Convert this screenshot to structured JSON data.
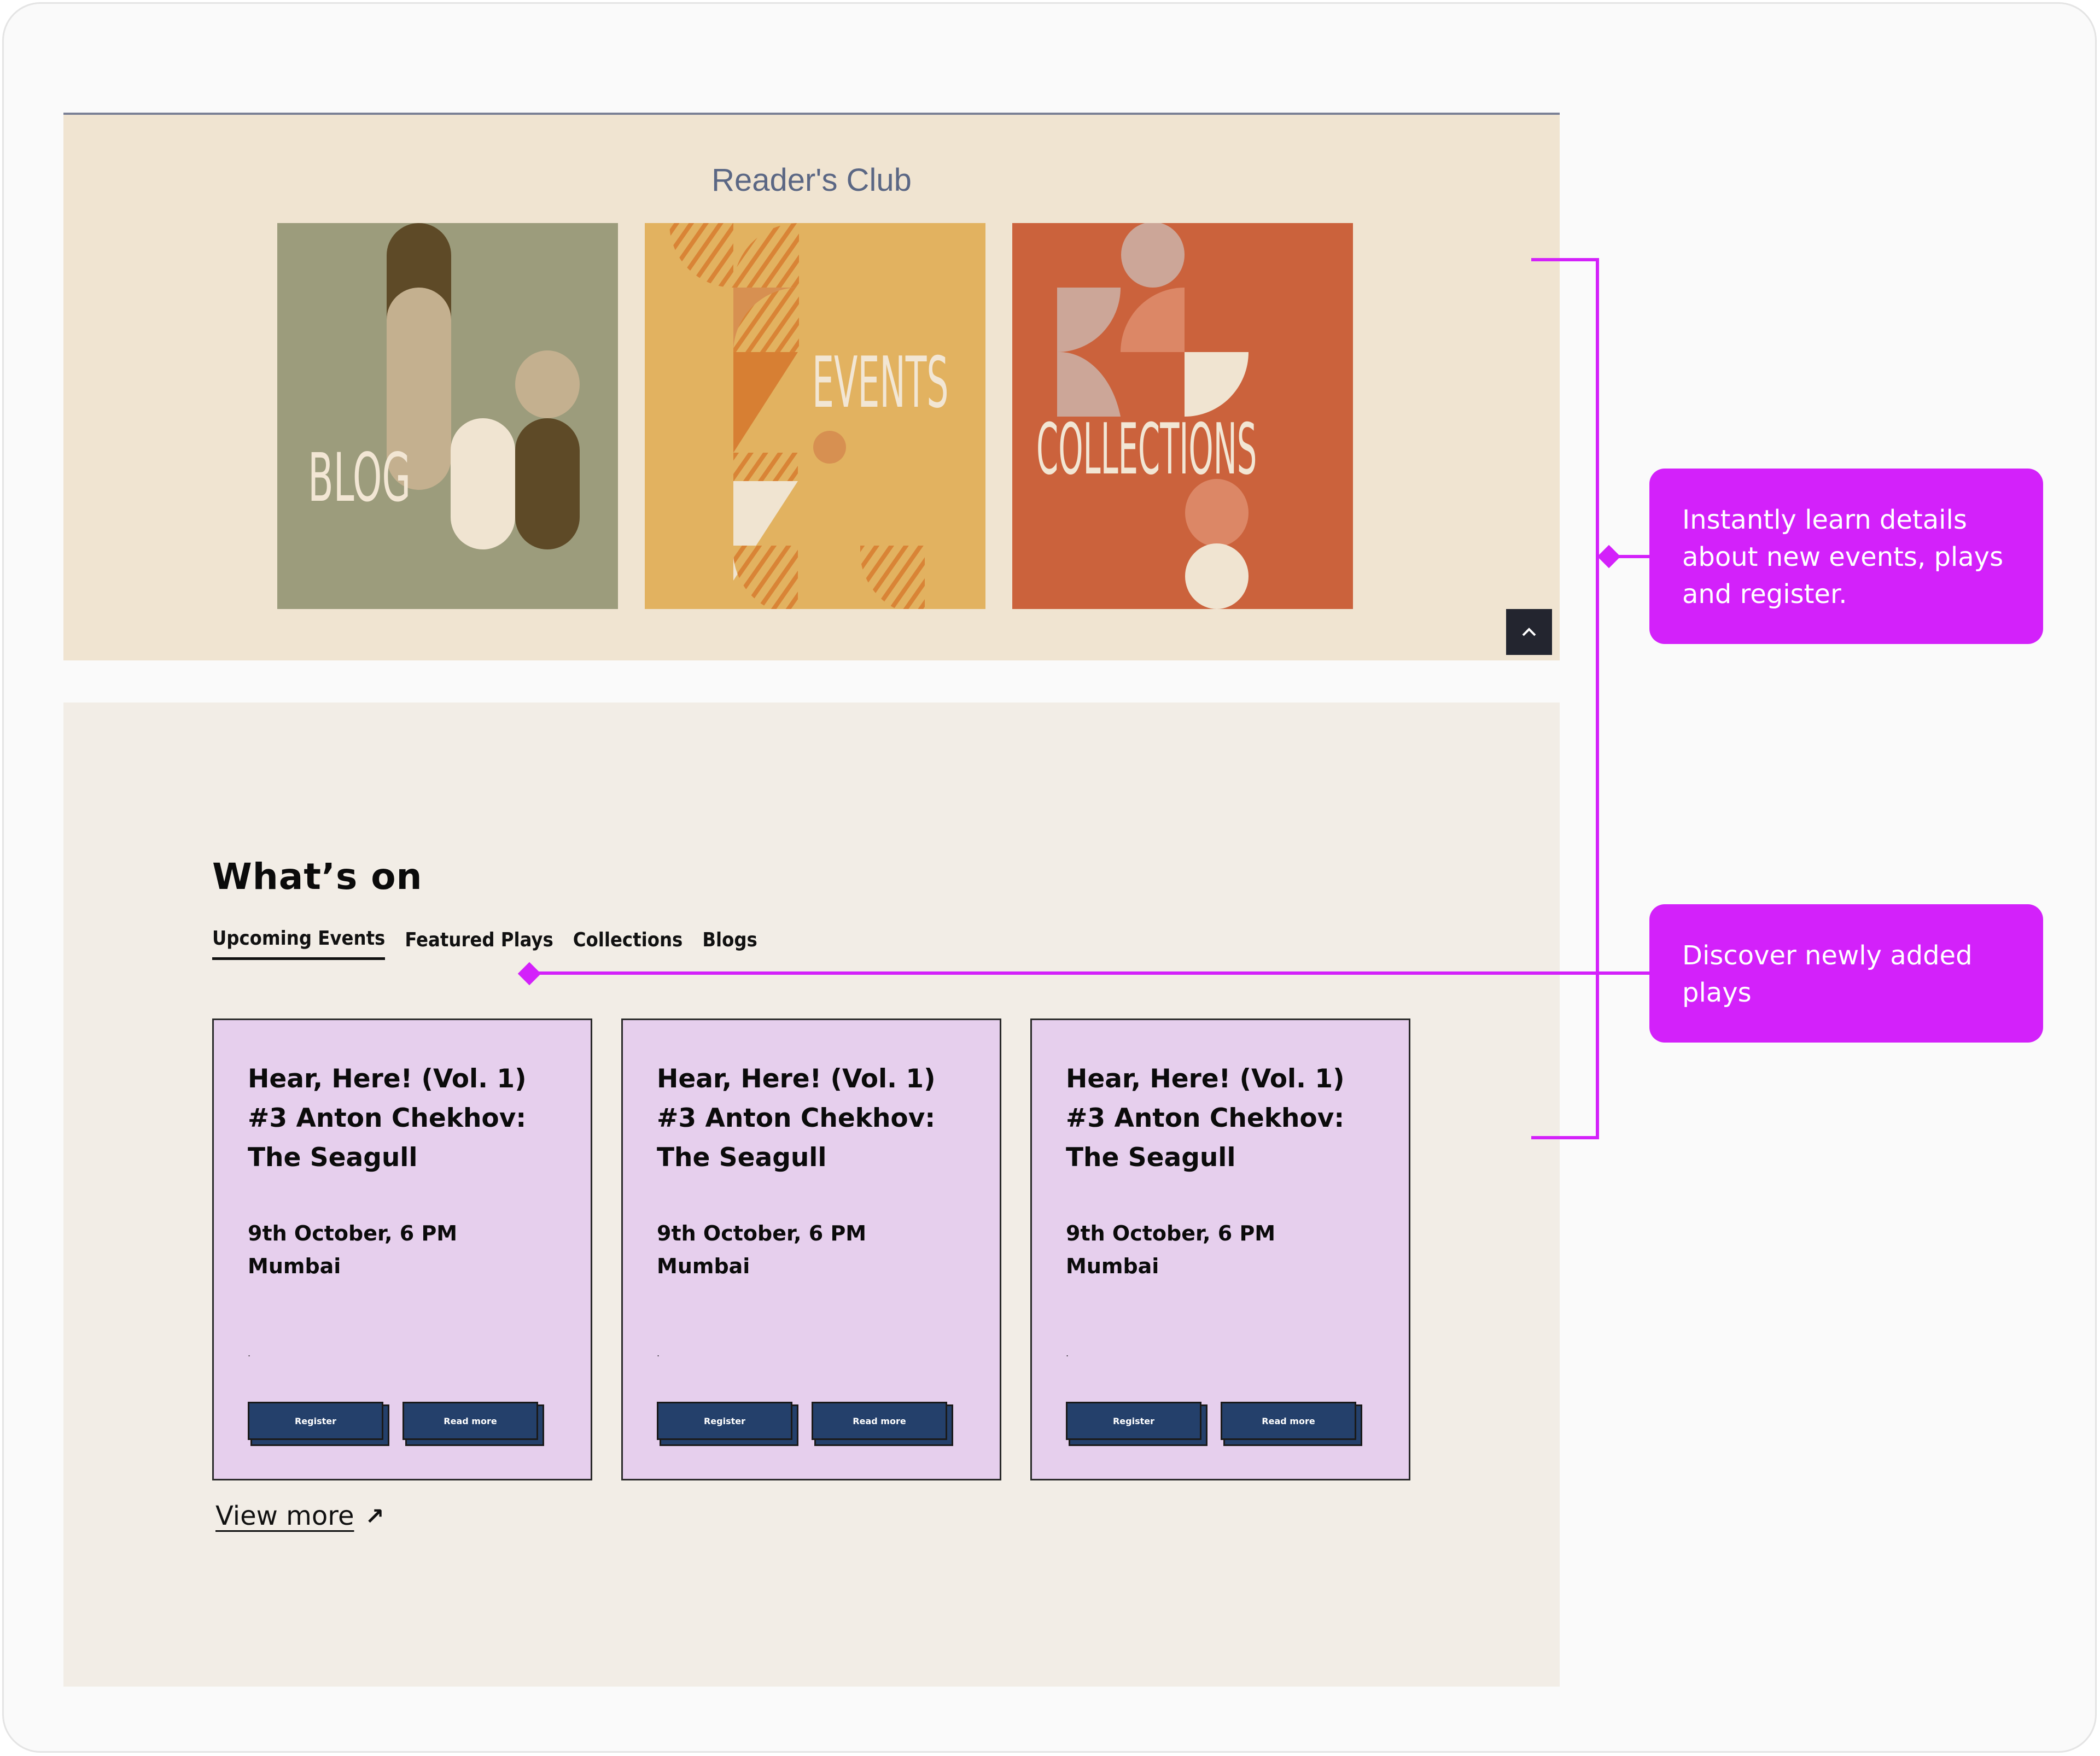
{
  "readers_club": {
    "title": "Reader's Club",
    "tiles": [
      {
        "label": "BLOG",
        "bg": "#9c9c7c"
      },
      {
        "label": "EVENTS",
        "bg": "#e2b260"
      },
      {
        "label": "COLLECTIONS",
        "bg": "#cb623c"
      }
    ],
    "scroll_top_icon": "chevron-up-icon"
  },
  "whats_on": {
    "title": "What’s on",
    "tabs": [
      {
        "label": "Upcoming Events",
        "active": true
      },
      {
        "label": "Featured Plays",
        "active": false
      },
      {
        "label": "Collections",
        "active": false
      },
      {
        "label": "Blogs",
        "active": false
      }
    ],
    "cards": [
      {
        "title": "Hear, Here! (Vol. 1) #3 Anton Chekhov: The Seagull",
        "date": "9th October, 6 PM",
        "location": "Mumbai",
        "excerpt": ".",
        "register_label": "Register",
        "read_more_label": "Read more"
      },
      {
        "title": "Hear, Here! (Vol. 1) #3 Anton Chekhov: The Seagull",
        "date": "9th October, 6 PM",
        "location": "Mumbai",
        "excerpt": ".",
        "register_label": "Register",
        "read_more_label": "Read more"
      },
      {
        "title": "Hear, Here! (Vol. 1) #3 Anton Chekhov: The Seagull",
        "date": "9th October, 6 PM",
        "location": "Mumbai",
        "excerpt": ".",
        "register_label": "Register",
        "read_more_label": "Read more"
      }
    ],
    "view_more_label": "View more",
    "view_more_icon": "arrow-up-right-icon"
  },
  "annotations": [
    {
      "text": "Instantly learn details about new events, plays and register."
    },
    {
      "text": "Discover newly added plays"
    }
  ],
  "colors": {
    "accent": "#d321fa",
    "button": "#24406b",
    "card_bg": "#e6cfed",
    "readers_club_bg": "#f0e4d1",
    "whats_on_bg": "#f2ede6"
  }
}
